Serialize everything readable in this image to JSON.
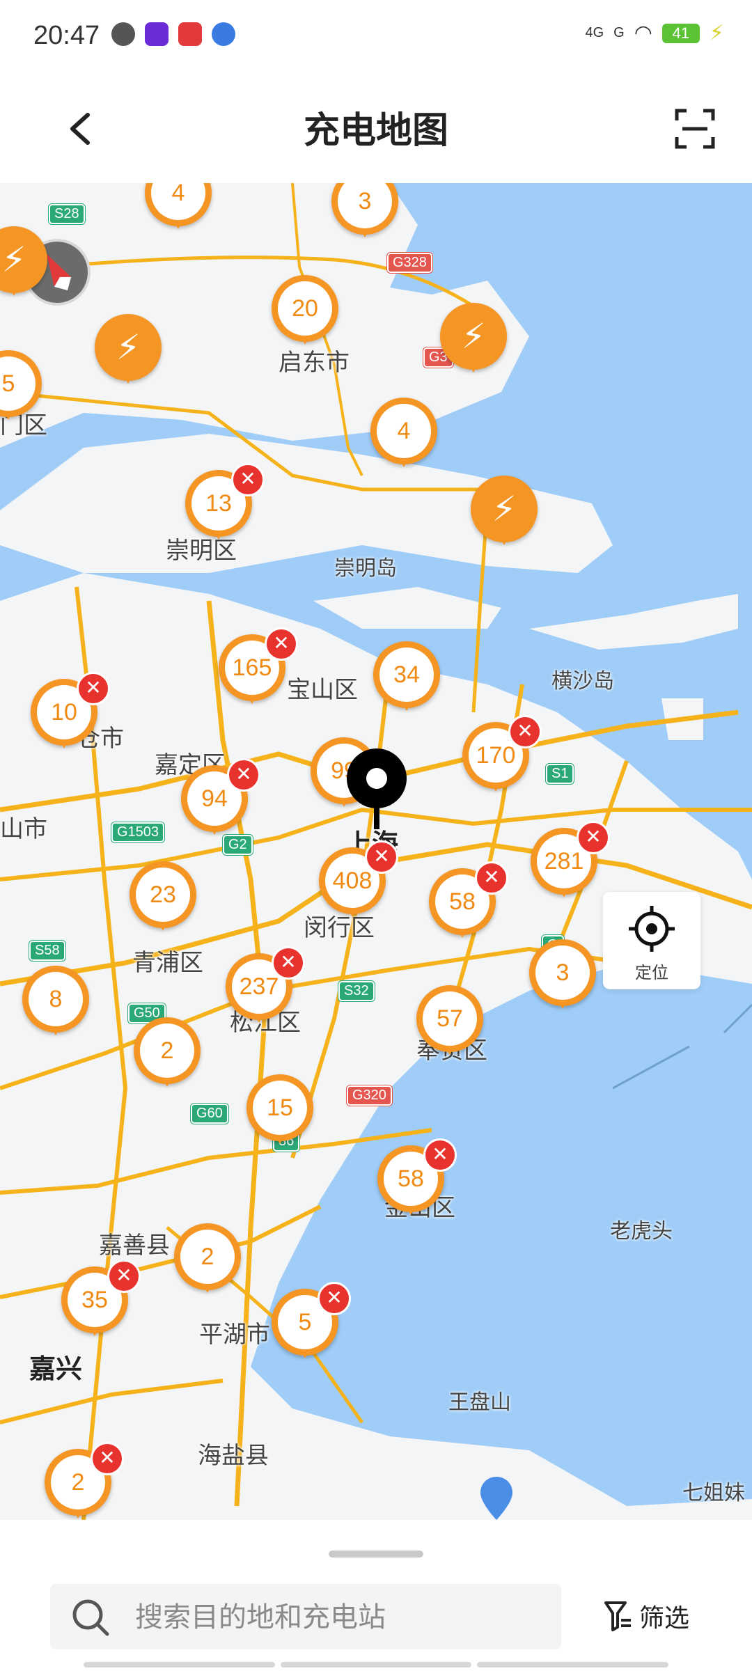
{
  "status_bar": {
    "time": "20:47",
    "network1": "4G",
    "network2": "G",
    "battery": "41"
  },
  "header": {
    "title": "充电地图",
    "back_icon": "chevron-left-icon",
    "scan_icon": "scan-icon"
  },
  "map": {
    "place_labels": [
      {
        "id": "qidong",
        "text": "启东市"
      },
      {
        "id": "chongming-qu",
        "text": "崇明区"
      },
      {
        "id": "chongming-dao",
        "text": "崇明岛"
      },
      {
        "id": "hengsha",
        "text": "横沙岛"
      },
      {
        "id": "baoshan",
        "text": "宝山区"
      },
      {
        "id": "jiading",
        "text": "嘉定区"
      },
      {
        "id": "shanghai",
        "text": "上海"
      },
      {
        "id": "minhang",
        "text": "闵行区"
      },
      {
        "id": "qingpu",
        "text": "青浦区"
      },
      {
        "id": "songjiang",
        "text": "松江区"
      },
      {
        "id": "fengxian",
        "text": "奉贤区"
      },
      {
        "id": "jinshan",
        "text": "金山区"
      },
      {
        "id": "jiashan",
        "text": "嘉善县"
      },
      {
        "id": "pinghu",
        "text": "平湖市"
      },
      {
        "id": "jiaxing",
        "text": "嘉兴"
      },
      {
        "id": "haiyan",
        "text": "海盐县"
      },
      {
        "id": "wangpan",
        "text": "王盘山"
      },
      {
        "id": "laohutou",
        "text": "老虎头"
      },
      {
        "id": "qijiemei",
        "text": "七姐妹"
      },
      {
        "id": "kunshan",
        "text": "山市"
      },
      {
        "id": "taicang",
        "text": "仓市"
      },
      {
        "id": "haimen",
        "text": "门区"
      }
    ],
    "road_shields": [
      {
        "id": "s28",
        "text": "S28",
        "color": "green"
      },
      {
        "id": "g328",
        "text": "G328",
        "color": "red"
      },
      {
        "id": "g3",
        "text": "G3",
        "color": "red"
      },
      {
        "id": "s1",
        "text": "S1",
        "color": "green"
      },
      {
        "id": "g1503",
        "text": "G1503",
        "color": "green"
      },
      {
        "id": "g2",
        "text": "G2",
        "color": "green"
      },
      {
        "id": "s58",
        "text": "S58",
        "color": "green"
      },
      {
        "id": "g50",
        "text": "G50",
        "color": "green"
      },
      {
        "id": "s32",
        "text": "S32",
        "color": "green"
      },
      {
        "id": "g60",
        "text": "G60",
        "color": "green"
      },
      {
        "id": "g320",
        "text": "G320",
        "color": "red"
      },
      {
        "id": "s36",
        "text": "36",
        "color": "green"
      },
      {
        "id": "g99",
        "text": "G",
        "color": "green"
      }
    ],
    "station_clusters": [
      {
        "id": "c1",
        "count": "4",
        "closed": false
      },
      {
        "id": "c2",
        "count": "3",
        "closed": false
      },
      {
        "id": "c3",
        "count": "20",
        "closed": false
      },
      {
        "id": "c4",
        "count": "5",
        "closed": false
      },
      {
        "id": "c5",
        "count": "4",
        "closed": false
      },
      {
        "id": "c6",
        "count": "13",
        "closed": true
      },
      {
        "id": "c7",
        "count": "165",
        "closed": true
      },
      {
        "id": "c8",
        "count": "34",
        "closed": false
      },
      {
        "id": "c9",
        "count": "10",
        "closed": true
      },
      {
        "id": "c10",
        "count": "99",
        "closed": false
      },
      {
        "id": "c11",
        "count": "94",
        "closed": true
      },
      {
        "id": "c12",
        "count": "170",
        "closed": true
      },
      {
        "id": "c13",
        "count": "408",
        "closed": true
      },
      {
        "id": "c14",
        "count": "58",
        "closed": true
      },
      {
        "id": "c15",
        "count": "281",
        "closed": true
      },
      {
        "id": "c16",
        "count": "23",
        "closed": false
      },
      {
        "id": "c17",
        "count": "3",
        "closed": false
      },
      {
        "id": "c18",
        "count": "8",
        "closed": false
      },
      {
        "id": "c19",
        "count": "237",
        "closed": true
      },
      {
        "id": "c20",
        "count": "2",
        "closed": false
      },
      {
        "id": "c21",
        "count": "57",
        "closed": false
      },
      {
        "id": "c22",
        "count": "15",
        "closed": false
      },
      {
        "id": "c23",
        "count": "58",
        "closed": true
      },
      {
        "id": "c24",
        "count": "2",
        "closed": false
      },
      {
        "id": "c25",
        "count": "35",
        "closed": true
      },
      {
        "id": "c26",
        "count": "5",
        "closed": true
      },
      {
        "id": "c27",
        "count": "2",
        "closed": true
      }
    ],
    "bolt_markers": [
      "b1",
      "b2",
      "b3",
      "b4"
    ],
    "locate_button": {
      "label": "定位",
      "icon": "crosshair-icon"
    },
    "compass_icon": "compass-icon"
  },
  "bottom": {
    "search": {
      "placeholder": "搜索目的地和充电站",
      "icon": "search-icon"
    },
    "filter": {
      "label": "筛选",
      "icon": "filter-icon"
    }
  },
  "colors": {
    "marker": "#f59524",
    "closed_badge": "#e8322e",
    "water": "#9fcdf8",
    "land": "#f4f5f6",
    "road": "#f6b21a"
  }
}
